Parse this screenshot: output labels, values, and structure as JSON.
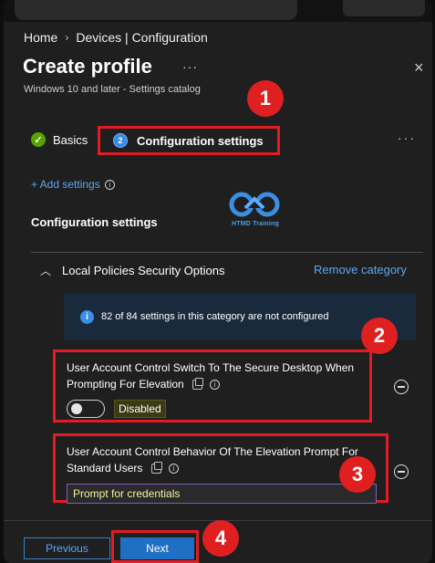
{
  "breadcrumb": {
    "home": "Home",
    "devices": "Devices | Configuration"
  },
  "header": {
    "title": "Create profile",
    "more": "···",
    "subtitle": "Windows 10 and later - Settings catalog",
    "close": "×"
  },
  "steps": {
    "basics_label": "Basics",
    "config_number": "2",
    "config_label": "Configuration settings",
    "more": "···"
  },
  "actions": {
    "add_settings": "+ Add settings"
  },
  "section": {
    "heading": "Configuration settings"
  },
  "logo": {
    "text": "HTMD Training"
  },
  "category": {
    "name": "Local Policies Security Options",
    "remove_label": "Remove category",
    "info_text": "82 of 84 settings in this category are not configured"
  },
  "settings": [
    {
      "label": "User Account Control Switch To The Secure Desktop When Prompting For Elevation",
      "value": "Disabled"
    },
    {
      "label": "User Account Control Behavior Of The Elevation Prompt For Standard Users",
      "value": "Prompt for credentials"
    }
  ],
  "badges": [
    "1",
    "2",
    "3",
    "4"
  ],
  "footer": {
    "previous": "Previous",
    "next": "Next"
  },
  "colors": {
    "accent": "#5ba7f0",
    "highlight": "#e31b23",
    "primary_button": "#1f6fc4",
    "success": "#57a300"
  }
}
